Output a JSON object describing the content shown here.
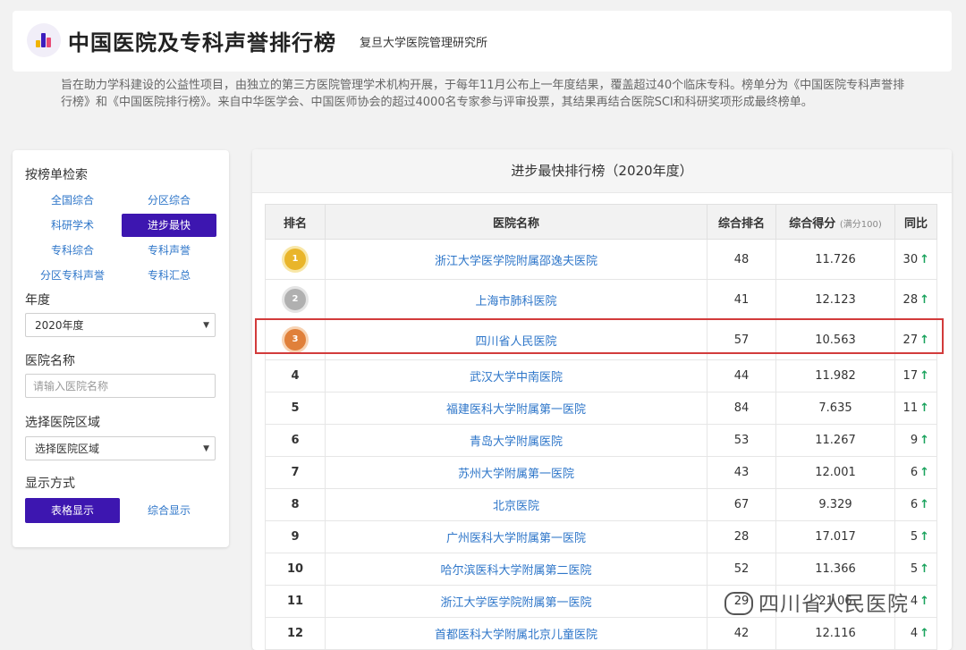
{
  "header": {
    "logo": "bar-chart-logo",
    "title": "中国医院及专科声誉排行榜",
    "subtitle": "复旦大学医院管理研究所",
    "description": "旨在助力学科建设的公益性项目，由独立的第三方医院管理学术机构开展，于每年11月公布上一年度结果，覆盖超过40个临床专科。榜单分为《中国医院专科声誉排行榜》和《中国医院排行榜》。来自中华医学会、中国医师协会的超过4000名专家参与评审投票，其结果再结合医院SCI和科研奖项形成最终榜单。"
  },
  "sidebar": {
    "search_by_list_label": "按榜单检索",
    "lists": [
      "全国综合",
      "分区综合",
      "科研学术",
      "进步最快",
      "专科综合",
      "专科声誉",
      "分区专科声誉",
      "专科汇总"
    ],
    "active_list": "进步最快",
    "year_label": "年度",
    "year_value": "2020年度",
    "hospital_name_label": "医院名称",
    "hospital_name_placeholder": "请输入医院名称",
    "region_label": "选择医院区域",
    "region_value": "选择医院区域",
    "display_label": "显示方式",
    "display_table": "表格显示",
    "display_combined": "综合显示"
  },
  "table": {
    "title": "进步最快排行榜（2020年度）",
    "columns": {
      "rank": "排名",
      "name": "医院名称",
      "overall_rank": "综合排名",
      "score": "综合得分",
      "score_note": "(满分100)",
      "yoy": "同比"
    },
    "rows": [
      {
        "rank": "1",
        "medal": "gold-medal",
        "name": "浙江大学医学院附属邵逸夫医院",
        "overall_rank": "48",
        "score": "11.726",
        "yoy": "30"
      },
      {
        "rank": "2",
        "medal": "silver-medal",
        "name": "上海市肺科医院",
        "overall_rank": "41",
        "score": "12.123",
        "yoy": "28"
      },
      {
        "rank": "3",
        "medal": "bronze-medal",
        "name": "四川省人民医院",
        "overall_rank": "57",
        "score": "10.563",
        "yoy": "27"
      },
      {
        "rank": "4",
        "medal": "",
        "name": "武汉大学中南医院",
        "overall_rank": "44",
        "score": "11.982",
        "yoy": "17"
      },
      {
        "rank": "5",
        "medal": "",
        "name": "福建医科大学附属第一医院",
        "overall_rank": "84",
        "score": "7.635",
        "yoy": "11"
      },
      {
        "rank": "6",
        "medal": "",
        "name": "青岛大学附属医院",
        "overall_rank": "53",
        "score": "11.267",
        "yoy": "9"
      },
      {
        "rank": "7",
        "medal": "",
        "name": "苏州大学附属第一医院",
        "overall_rank": "43",
        "score": "12.001",
        "yoy": "6"
      },
      {
        "rank": "8",
        "medal": "",
        "name": "北京医院",
        "overall_rank": "67",
        "score": "9.329",
        "yoy": "6"
      },
      {
        "rank": "9",
        "medal": "",
        "name": "广州医科大学附属第一医院",
        "overall_rank": "28",
        "score": "17.017",
        "yoy": "5"
      },
      {
        "rank": "10",
        "medal": "",
        "name": "哈尔滨医科大学附属第二医院",
        "overall_rank": "52",
        "score": "11.366",
        "yoy": "5"
      },
      {
        "rank": "11",
        "medal": "",
        "name": "浙江大学医学院附属第一医院",
        "overall_rank": "29",
        "score": "21.06",
        "yoy": "4"
      },
      {
        "rank": "12",
        "medal": "",
        "name": "首都医科大学附属北京儿童医院",
        "overall_rank": "42",
        "score": "12.116",
        "yoy": "4"
      }
    ],
    "highlight_row": "3",
    "up_arrow": "↑",
    "up_color": "#1aa35d"
  },
  "watermark": {
    "text": "四川省人民医院",
    "icon": "wechat-icon"
  },
  "colors": {
    "accent": "#3d16b0",
    "link": "#2e76c9",
    "highlight": "#d23b3b"
  }
}
